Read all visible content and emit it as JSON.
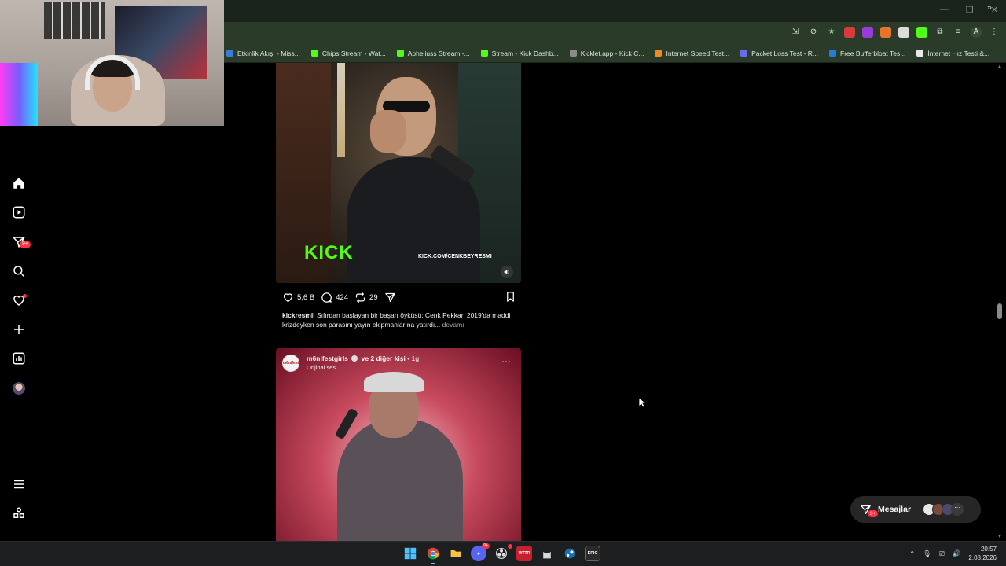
{
  "browser": {
    "bookmarks": [
      {
        "label": "Etkinlik Akışı - Miss...",
        "color": "#3d7bd9"
      },
      {
        "label": "Chips Stream - Wat...",
        "color": "#53fc18"
      },
      {
        "label": "Apheliuss Stream -...",
        "color": "#53fc18"
      },
      {
        "label": "Stream - Kick Dashb...",
        "color": "#53fc18"
      },
      {
        "label": "Kicklet.app - Kick C...",
        "color": "#8a8a8a"
      },
      {
        "label": "Internet Speed Test...",
        "color": "#f08a24"
      },
      {
        "label": "Packet Loss Test - R...",
        "color": "#6a6af0"
      },
      {
        "label": "Free Bufferbloat Tes...",
        "color": "#2a7ad9"
      },
      {
        "label": "İnternet Hız Testi &...",
        "color": "#e8e8e8"
      }
    ],
    "bookmarks_overflow": "»",
    "profile_initial": "A"
  },
  "nav": {
    "notifications_badge": "9+"
  },
  "post1": {
    "overlay_brand": "KICK",
    "overlay_url": "KICK.COM/CENKBEYRESMI",
    "likes": "5,6 B",
    "comments": "424",
    "reposts": "29",
    "caption_user": "kickresmii",
    "caption_text": "Sıfırdan başlayan bir başarı öyküsü: Cenk Pekkan 2019'da maddi krizdeyken son parasını yayın ekipmanlarına yatırdı...",
    "caption_more": "devamı"
  },
  "post2": {
    "username": "m6nifestgirls",
    "coauthors": "ve 2 diğer kişi",
    "time": "1g",
    "audio": "Orijinal ses",
    "avatar_text": "m6nifest"
  },
  "messages": {
    "label": "Mesajlar",
    "badge": "9+"
  },
  "taskbar": {
    "time": "20:57",
    "date": "2.08.2026",
    "discord_badge": "9+",
    "app_label_epic": "EPIC",
    "app_label_wttr": "WTTR"
  },
  "colors": {
    "kick_green": "#53fc18",
    "badge_red": "#ff3040",
    "chrome_green": "#2a3b2a"
  }
}
